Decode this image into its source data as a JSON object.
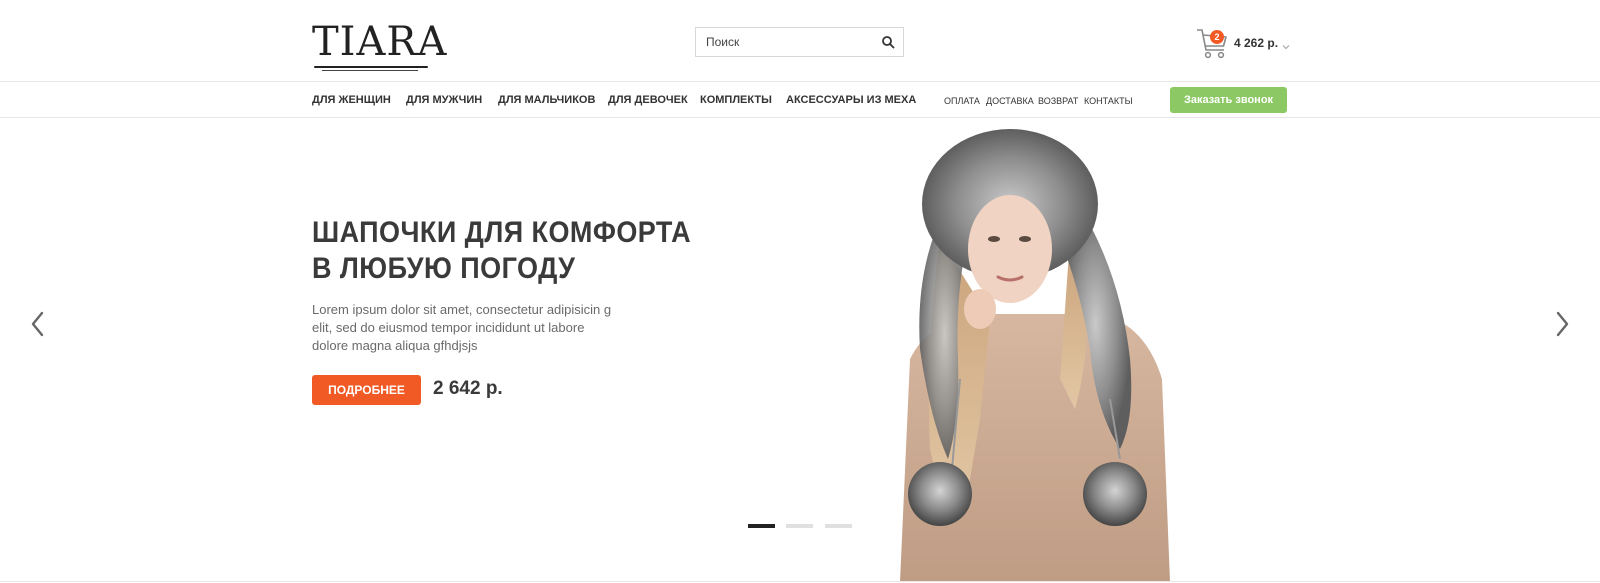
{
  "header": {
    "logo_text": "TIARA",
    "search": {
      "placeholder": "Поиск",
      "value": ""
    },
    "cart": {
      "count": "2",
      "total": "4 262 р."
    }
  },
  "nav": {
    "categories": [
      {
        "label": "ДЛЯ ЖЕНЩИН"
      },
      {
        "label": "ДЛЯ МУЖЧИН"
      },
      {
        "label": "ДЛЯ МАЛЬЧИКОВ"
      },
      {
        "label": "ДЛЯ ДЕВОЧЕК"
      },
      {
        "label": "КОМПЛЕКТЫ"
      },
      {
        "label": "АКСЕССУАРЫ ИЗ МЕХА"
      }
    ],
    "info_links": [
      {
        "label": "ОПЛАТА"
      },
      {
        "label": "ДОСТАВКА"
      },
      {
        "label": "ВОЗВРАТ"
      },
      {
        "label": "КОНТАКТЫ"
      }
    ],
    "callback_label": "Заказать звонок"
  },
  "slider": {
    "title_line1": "ШАПОЧКИ ДЛЯ КОМФОРТА",
    "title_line2": "В ЛЮБУЮ ПОГОДУ",
    "description": "Lorem ipsum dolor sit amet, consectetur adipisicin g elit, sed do eiusmod tempor incididunt ut labore dolore magna aliqua gfhdjsjs",
    "more_label": "ПОДРОБНЕЕ",
    "price": "2 642 р.",
    "active_slide": 1,
    "slide_count": 3
  },
  "colors": {
    "accent_orange": "#f15a24",
    "accent_green": "#8cc864",
    "text_dark": "#333333"
  },
  "icons": [
    "search-icon",
    "cart-icon",
    "chevron-down-icon",
    "arrow-left-icon",
    "arrow-right-icon"
  ]
}
